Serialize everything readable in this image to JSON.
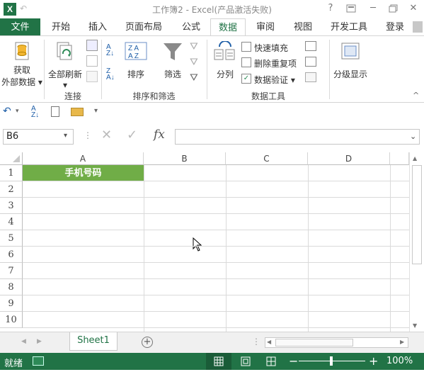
{
  "title_bar": {
    "title": "工作簿2 - Excel(产品激活失败)",
    "excel_logo": "X",
    "help": "?",
    "min": "─",
    "close": "✕"
  },
  "tabs": [
    {
      "label": "文件"
    },
    {
      "label": "开始"
    },
    {
      "label": "插入"
    },
    {
      "label": "页面布局"
    },
    {
      "label": "公式"
    },
    {
      "label": "数据"
    },
    {
      "label": "审阅"
    },
    {
      "label": "视图"
    },
    {
      "label": "开发工具"
    },
    {
      "label": "登录"
    }
  ],
  "ribbon": {
    "get_external_data_line1": "获取",
    "get_external_data_line2": "外部数据",
    "refresh_all": "全部刷新",
    "sort": "排序",
    "filter": "筛选",
    "text_to_columns": "分列",
    "flash_fill": "快速填充",
    "remove_duplicates": "删除重复项",
    "data_validation": "数据验证",
    "group_outline": "分级显示",
    "group_connections": "连接",
    "group_sort_filter": "排序和筛选",
    "group_data_tools": "数据工具"
  },
  "formula_bar": {
    "name_box": "B6",
    "fx": "fx",
    "value": ""
  },
  "grid": {
    "columns": [
      "A",
      "B",
      "C",
      "D"
    ],
    "rows": [
      "1",
      "2",
      "3",
      "4",
      "5",
      "6",
      "7",
      "8",
      "9",
      "10"
    ],
    "a1": "手机号码"
  },
  "sheets": {
    "active": "Sheet1"
  },
  "status": {
    "ready": "就绪",
    "zoom": "100%",
    "minus": "−",
    "plus": "+"
  },
  "colors": {
    "excel_green": "#217346",
    "header_fill": "#70ad47"
  }
}
